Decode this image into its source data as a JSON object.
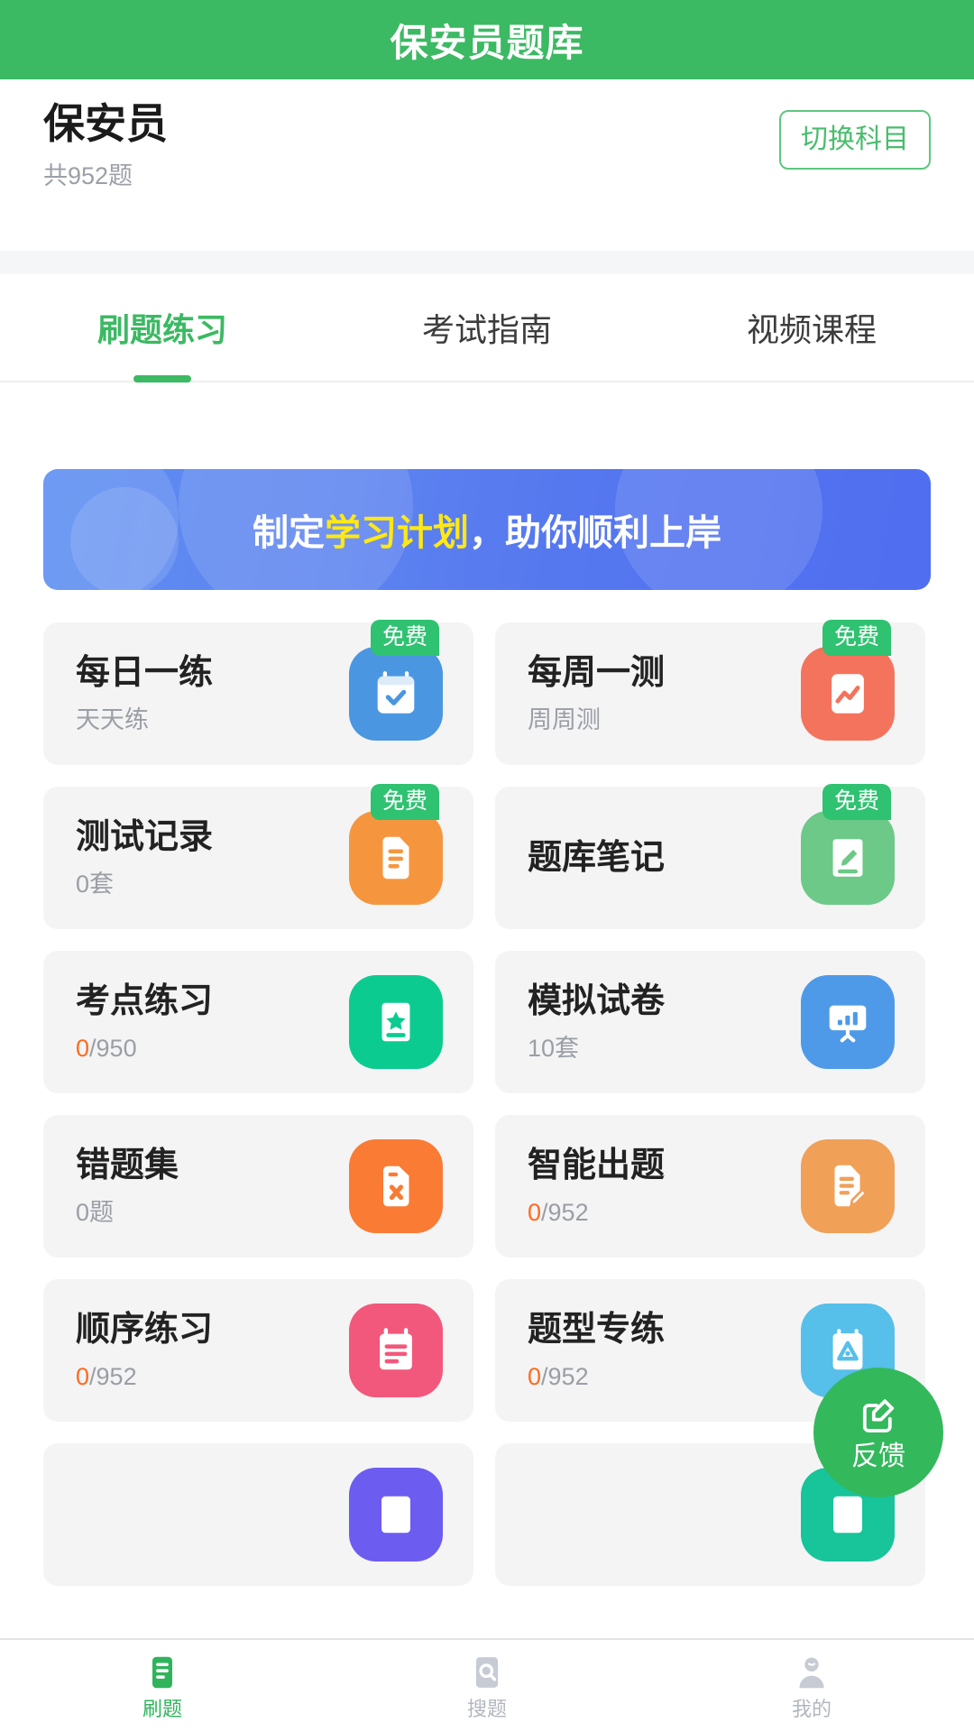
{
  "topbar": {
    "title": "保安员题库"
  },
  "subject": {
    "name": "保安员",
    "count": "共952题",
    "switch_label": "切换科目"
  },
  "tabs": [
    {
      "label": "刷题练习",
      "active": true
    },
    {
      "label": "考试指南",
      "active": false
    },
    {
      "label": "视频课程",
      "active": false
    }
  ],
  "banner": {
    "prefix": "制定",
    "highlight": "学习计划",
    "suffix": "，助你顺利上岸",
    "highlight_color": "#ffe814"
  },
  "badge_label": "免费",
  "cards": [
    {
      "title": "每日一练",
      "sub": "天天练",
      "sub_zero": "",
      "badge": "免费",
      "icon": "calendar-check-icon",
      "color": "#4a96e0"
    },
    {
      "title": "每周一测",
      "sub": "周周测",
      "sub_zero": "",
      "badge": "免费",
      "icon": "chart-report-icon",
      "color": "#f4735c"
    },
    {
      "title": "测试记录",
      "sub": "0套",
      "sub_zero": "",
      "badge": "免费",
      "icon": "document-lines-icon",
      "color": "#f5963e"
    },
    {
      "title": "题库笔记",
      "sub": "",
      "sub_zero": "",
      "badge": "免费",
      "icon": "note-pencil-icon",
      "color": "#6cc987"
    },
    {
      "title": "考点练习",
      "sub": "/950",
      "sub_zero": "0",
      "badge": "",
      "icon": "star-card-icon",
      "color": "#0ccb91"
    },
    {
      "title": "模拟试卷",
      "sub": "10套",
      "sub_zero": "",
      "badge": "",
      "icon": "chart-board-icon",
      "color": "#4e9ae8"
    },
    {
      "title": "错题集",
      "sub": "0题",
      "sub_zero": "",
      "badge": "",
      "icon": "wrong-doc-icon",
      "color": "#f97b34"
    },
    {
      "title": "智能出题",
      "sub": "/952",
      "sub_zero": "0",
      "badge": "",
      "icon": "smart-doc-icon",
      "color": "#f0a057"
    },
    {
      "title": "顺序练习",
      "sub": "/952",
      "sub_zero": "0",
      "badge": "",
      "icon": "order-calendar-icon",
      "color": "#f2587b"
    },
    {
      "title": "题型专练",
      "sub": "/952",
      "sub_zero": "0",
      "badge": "",
      "icon": "triangle-card-icon",
      "color": "#56bfea"
    },
    {
      "title": "",
      "sub": "",
      "sub_zero": "",
      "badge": "",
      "icon": "purple-card-icon",
      "color": "#6c5cf0"
    },
    {
      "title": "",
      "sub": "",
      "sub_zero": "",
      "badge": "",
      "icon": "teal-card-icon",
      "color": "#18c49a"
    }
  ],
  "fab": {
    "label": "反馈",
    "icon": "edit-feedback-icon",
    "color": "#33b85c"
  },
  "tabbar": [
    {
      "label": "刷题",
      "icon": "doc-lines-icon",
      "active": true
    },
    {
      "label": "搜题",
      "icon": "search-icon",
      "active": false
    },
    {
      "label": "我的",
      "icon": "user-icon",
      "active": false
    }
  ],
  "theme": {
    "primary": "#3cb963",
    "accent_orange": "#ff6a1e",
    "card_bg": "#f4f4f5"
  }
}
